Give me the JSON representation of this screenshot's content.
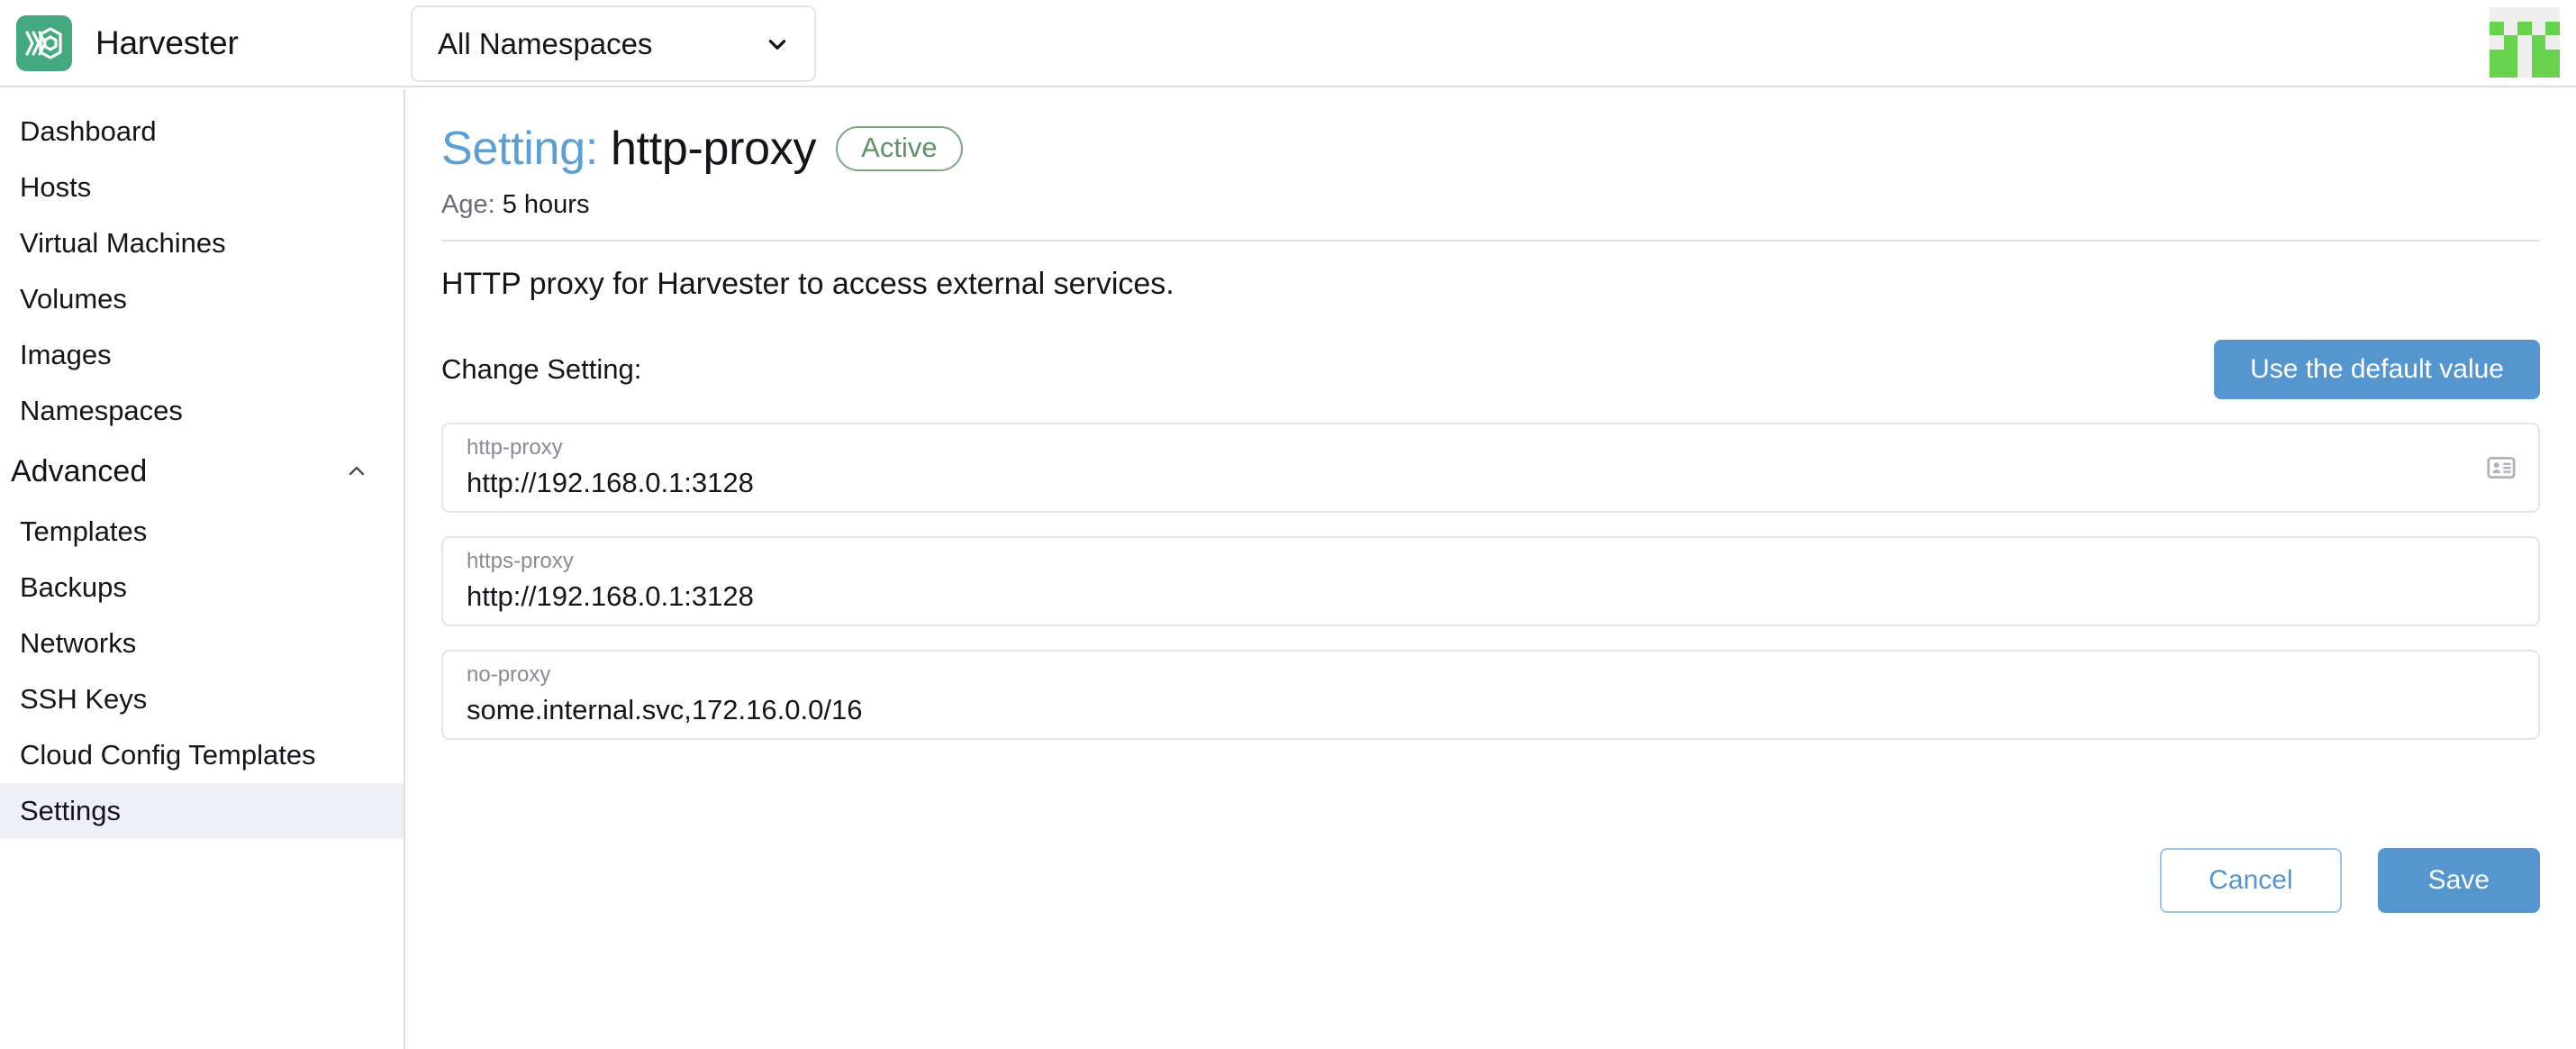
{
  "header": {
    "brand_name": "Harvester",
    "logo_icon": "harvester-logo-icon",
    "namespace_select": {
      "value": "All Namespaces",
      "icon": "chevron-down-icon"
    },
    "avatar_icon": "user-avatar-identicon",
    "avatar_color": "#68d24c"
  },
  "sidebar": {
    "items": [
      {
        "label": "Dashboard",
        "active": false
      },
      {
        "label": "Hosts",
        "active": false
      },
      {
        "label": "Virtual Machines",
        "active": false
      },
      {
        "label": "Volumes",
        "active": false
      },
      {
        "label": "Images",
        "active": false
      },
      {
        "label": "Namespaces",
        "active": false
      }
    ],
    "group": {
      "label": "Advanced",
      "icon": "chevron-up-icon",
      "expanded": true,
      "items": [
        {
          "label": "Templates",
          "active": false
        },
        {
          "label": "Backups",
          "active": false
        },
        {
          "label": "Networks",
          "active": false
        },
        {
          "label": "SSH Keys",
          "active": false
        },
        {
          "label": "Cloud Config Templates",
          "active": false
        },
        {
          "label": "Settings",
          "active": true
        }
      ]
    }
  },
  "main": {
    "title_prefix": "Setting:",
    "title_name": "http-proxy",
    "status_badge": "Active",
    "age_label": "Age:",
    "age_value": "5 hours",
    "description": "HTTP proxy for Harvester to access external services.",
    "change_setting_label": "Change Setting:",
    "default_button": "Use the default value",
    "fields": [
      {
        "label": "http-proxy",
        "value": "http://192.168.0.1:3128",
        "icon": "contact-card-icon"
      },
      {
        "label": "https-proxy",
        "value": "http://192.168.0.1:3128",
        "icon": ""
      },
      {
        "label": "no-proxy",
        "value": "some.internal.svc,172.16.0.0/16",
        "icon": ""
      }
    ],
    "cancel_button": "Cancel",
    "save_button": "Save"
  },
  "colors": {
    "brand_green": "#45a97f",
    "accent_blue": "#5596ce",
    "title_blue": "#5b9fd4",
    "active_green": "#5f9166",
    "sidebar_active_bg": "#eef0f5"
  }
}
